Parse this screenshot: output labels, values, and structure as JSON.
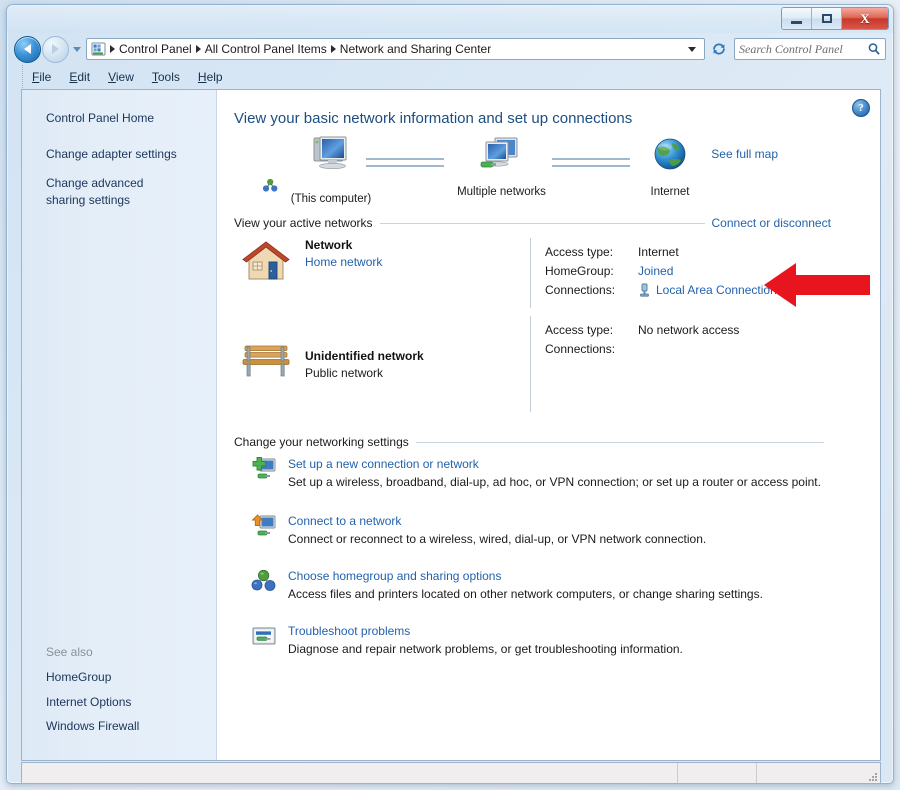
{
  "window": {
    "minimize_label": "Minimize",
    "maximize_label": "Maximize",
    "close_label": "Close",
    "close_glyph": "X"
  },
  "navigation": {
    "back_label": "Back",
    "forward_label": "Forward",
    "recent_pages_label": "Recent pages",
    "refresh_label": "Refresh",
    "breadcrumbs": [
      {
        "label": "Control Panel"
      },
      {
        "label": "All Control Panel Items"
      },
      {
        "label": "Network and Sharing Center"
      }
    ]
  },
  "search": {
    "placeholder": "Search Control Panel",
    "value": "",
    "icon": "search-icon"
  },
  "menubar": {
    "items": [
      {
        "accesskey": "F",
        "rest": "ile"
      },
      {
        "accesskey": "E",
        "rest": "dit"
      },
      {
        "accesskey": "V",
        "rest": "iew"
      },
      {
        "accesskey": "T",
        "rest": "ools"
      },
      {
        "accesskey": "H",
        "rest": "elp"
      }
    ]
  },
  "sidebar": {
    "items": [
      {
        "label": "Control Panel Home"
      },
      {
        "label": "Change adapter settings"
      },
      {
        "label": "Change advanced sharing settings"
      }
    ],
    "see_also_title": "See also",
    "see_also_items": [
      {
        "label": "HomeGroup"
      },
      {
        "label": "Internet Options"
      },
      {
        "label": "Windows Firewall"
      }
    ]
  },
  "content": {
    "help_glyph": "?",
    "page_title": "View your basic network information and set up connections",
    "network_map": {
      "see_full_map": "See full map",
      "nodes": [
        {
          "label": "(This computer)",
          "icon": "computer-icon"
        },
        {
          "label": "Multiple networks",
          "icon": "multiple-networks-icon"
        },
        {
          "label": "Internet",
          "icon": "internet-globe-icon"
        }
      ]
    },
    "active_networks": {
      "heading": "View your active networks",
      "action_link": "Connect or disconnect",
      "entries": [
        {
          "name": "Network",
          "type": "Home network",
          "type_is_link": true,
          "icon": "home-network-icon",
          "details": [
            {
              "key": "Access type:",
              "value": "Internet",
              "is_link": false,
              "has_icon": false
            },
            {
              "key": "HomeGroup:",
              "value": "Joined",
              "is_link": true,
              "has_icon": false
            },
            {
              "key": "Connections:",
              "value": "Local Area Connection",
              "is_link": true,
              "has_icon": true,
              "icon": "network-adapter-icon"
            }
          ]
        },
        {
          "name": "Unidentified network",
          "type": "Public network",
          "type_is_link": false,
          "icon": "public-network-bench-icon",
          "details": [
            {
              "key": "Access type:",
              "value": "No network access",
              "is_link": false,
              "has_icon": false
            },
            {
              "key": "Connections:",
              "value": "",
              "is_link": false,
              "has_icon": false
            }
          ]
        }
      ]
    },
    "settings": {
      "heading": "Change your networking settings",
      "items": [
        {
          "link": "Set up a new connection or network",
          "desc": "Set up a wireless, broadband, dial-up, ad hoc, or VPN connection; or set up a router or access point.",
          "icon": "new-connection-icon"
        },
        {
          "link": "Connect to a network",
          "desc": "Connect or reconnect to a wireless, wired, dial-up, or VPN network connection.",
          "icon": "connect-network-icon"
        },
        {
          "link": "Choose homegroup and sharing options",
          "desc": "Access files and printers located on other network computers, or change sharing settings.",
          "icon": "homegroup-sharing-icon"
        },
        {
          "link": "Troubleshoot problems",
          "desc": "Diagnose and repair network problems, or get troubleshooting information.",
          "icon": "troubleshoot-icon"
        }
      ]
    }
  },
  "annotation": {
    "arrow_color": "#e8151e",
    "points_at": "Local Area Connection"
  },
  "statusbar": {
    "text": ""
  }
}
